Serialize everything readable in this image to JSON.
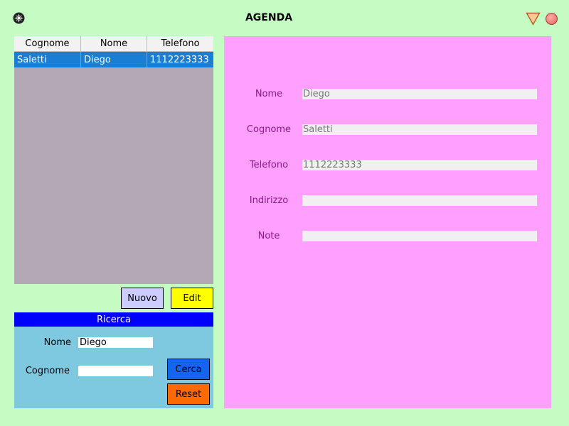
{
  "window": {
    "title": "AGENDA",
    "app_icon": "gear-icon",
    "minimize_icon": "triangle-down-icon",
    "close_icon": "close-circle-icon"
  },
  "table": {
    "columns": [
      "Cognome",
      "Nome",
      "Telefono"
    ],
    "rows": [
      {
        "cognome": "Saletti",
        "nome": "Diego",
        "telefono": "1112223333",
        "selected": true
      }
    ]
  },
  "actions": {
    "nuovo_label": "Nuovo",
    "edit_label": "Edit"
  },
  "search": {
    "title": "Ricerca",
    "nome_label": "Nome",
    "nome_value": "Diego",
    "cognome_label": "Cognome",
    "cognome_value": "",
    "cerca_label": "Cerca",
    "reset_label": "Reset"
  },
  "detail": {
    "fields": [
      {
        "label": "Nome",
        "value": "Diego"
      },
      {
        "label": "Cognome",
        "value": "Saletti"
      },
      {
        "label": "Telefono",
        "value": "1112223333"
      },
      {
        "label": "Indirizzo",
        "value": ""
      },
      {
        "label": "Note",
        "value": ""
      }
    ]
  },
  "colors": {
    "background": "#c4fcc4",
    "selection": "#1a7fd4",
    "detail_panel": "#ffa0ff",
    "search_panel": "#7ec8e0",
    "search_header": "#0000ff",
    "edit_button": "#ffff00",
    "nuovo_button": "#ccccff",
    "cerca_button": "#1464f0",
    "reset_button": "#ff6a00"
  }
}
